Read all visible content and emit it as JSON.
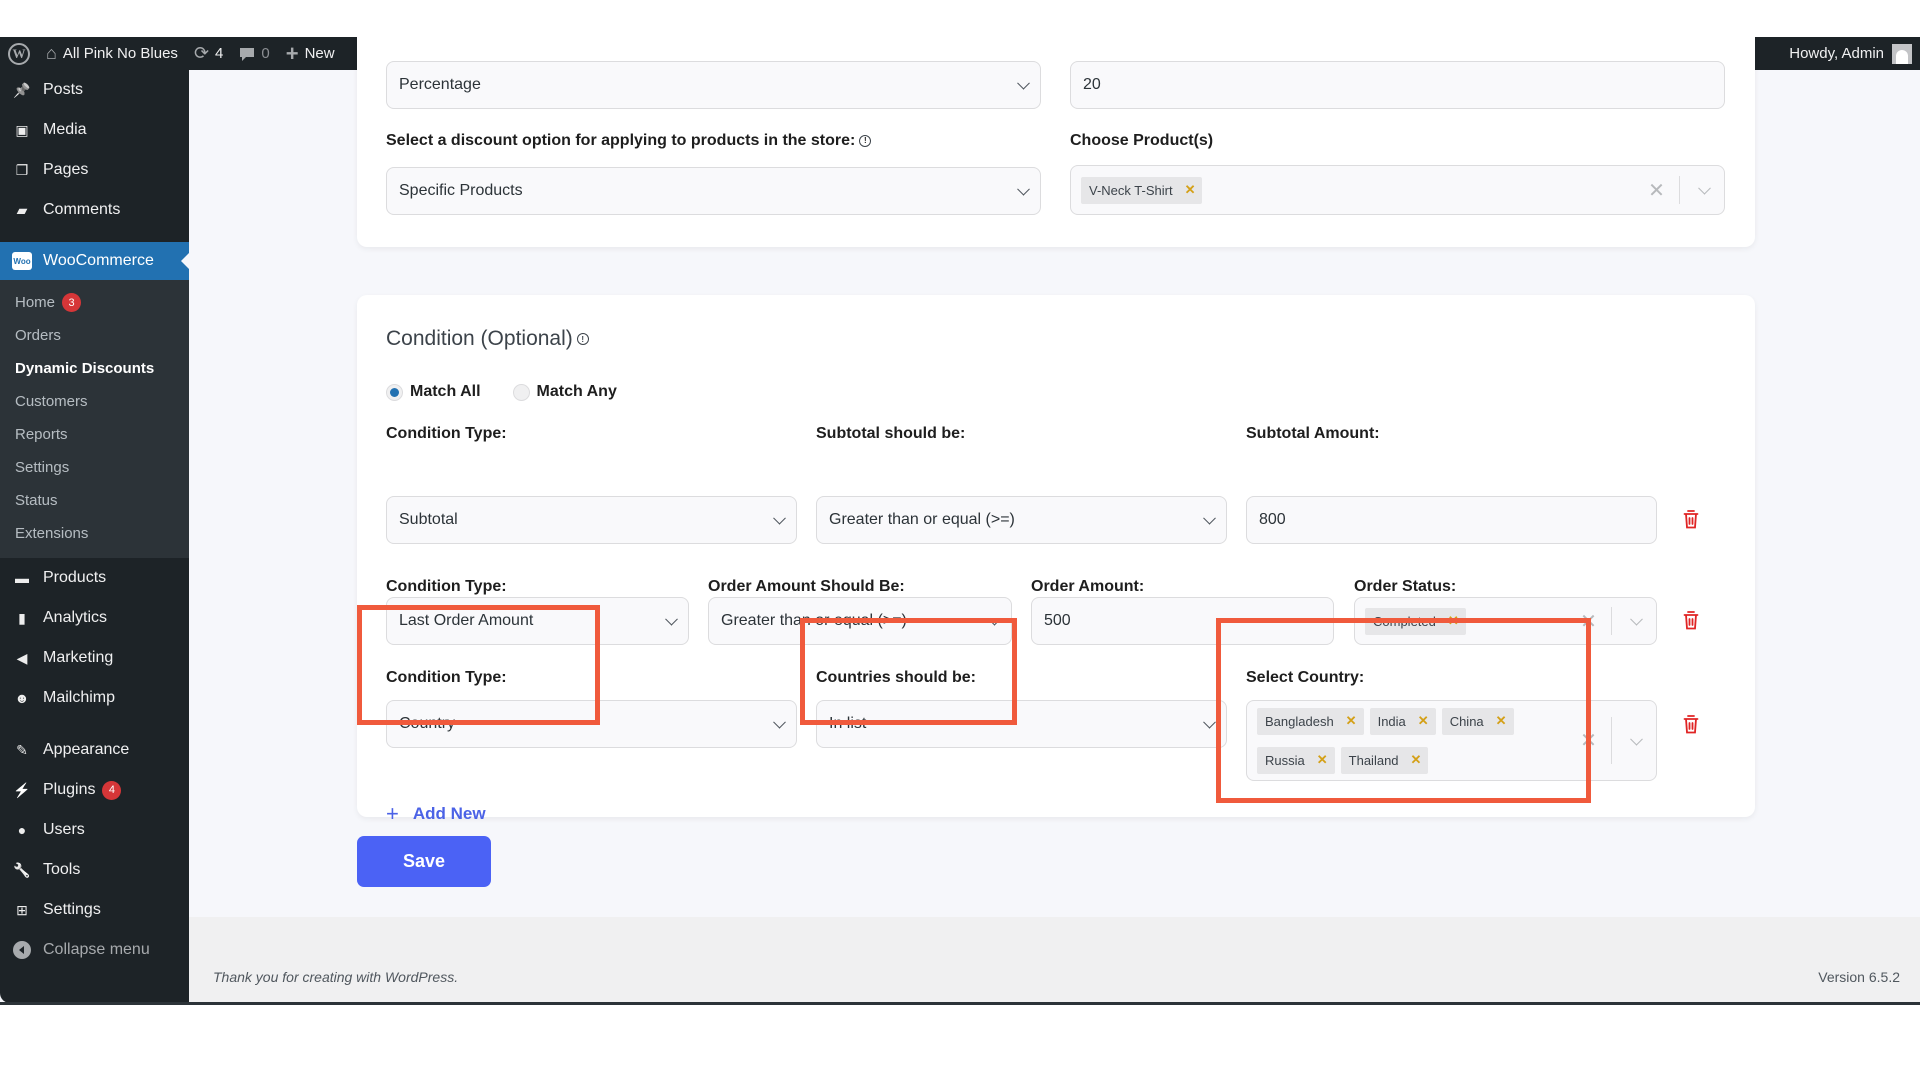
{
  "admin_bar": {
    "site_name": "All Pink No Blues",
    "updates_count": "4",
    "comments_count": "0",
    "new_label": "New",
    "greeting": "Howdy, Admin"
  },
  "sidebar": {
    "top_items": [
      {
        "label": "Posts",
        "icon": "pin-icon"
      },
      {
        "label": "Media",
        "icon": "media-icon"
      },
      {
        "label": "Pages",
        "icon": "pages-icon"
      },
      {
        "label": "Comments",
        "icon": "comment-icon"
      }
    ],
    "woocommerce": {
      "label": "WooCommerce",
      "logo_text": "Woo",
      "submenu": [
        {
          "label": "Home",
          "badge": "3"
        },
        {
          "label": "Orders"
        },
        {
          "label": "Dynamic Discounts",
          "current": true
        },
        {
          "label": "Customers"
        },
        {
          "label": "Reports"
        },
        {
          "label": "Settings"
        },
        {
          "label": "Status"
        },
        {
          "label": "Extensions"
        }
      ]
    },
    "mid_items": [
      {
        "label": "Products",
        "icon": "archive-icon"
      },
      {
        "label": "Analytics",
        "icon": "bar-chart-icon"
      },
      {
        "label": "Marketing",
        "icon": "megaphone-icon"
      },
      {
        "label": "Mailchimp",
        "icon": "mailchimp-icon"
      }
    ],
    "bottom_items": [
      {
        "label": "Appearance",
        "icon": "paintbrush-icon"
      },
      {
        "label": "Plugins",
        "icon": "plugin-icon",
        "badge": "4"
      },
      {
        "label": "Users",
        "icon": "user-icon"
      },
      {
        "label": "Tools",
        "icon": "wrench-icon"
      },
      {
        "label": "Settings",
        "icon": "settings-icon"
      }
    ],
    "collapse_label": "Collapse menu"
  },
  "discount": {
    "type_value": "Percentage",
    "amount_value": "20",
    "apply_label": "Select a discount option for applying to products in the store:",
    "apply_value": "Specific Products",
    "products_label": "Choose Product(s)",
    "products": [
      "V-Neck T-Shirt"
    ]
  },
  "conditions": {
    "heading": "Condition (Optional)",
    "match_all": "Match All",
    "match_any": "Match Any",
    "match_selected": "all",
    "rows": [
      {
        "type_label": "Condition Type:",
        "type_value": "Subtotal",
        "op_label": "Subtotal should be:",
        "op_value": "Greater than or equal (>=)",
        "amount_label": "Subtotal Amount:",
        "amount_value": "800"
      },
      {
        "type_label": "Condition Type:",
        "type_value": "Last Order Amount",
        "op_label": "Order Amount Should Be:",
        "op_value": "Greater than or equal (>=)",
        "amount_label": "Order Amount:",
        "amount_value": "500",
        "status_label": "Order Status:",
        "status_tags": [
          "Completed"
        ]
      },
      {
        "type_label": "Condition Type:",
        "type_value": "Country",
        "op_label": "Countries should be:",
        "op_value": "In list",
        "country_label": "Select Country:",
        "country_tags": [
          "Bangladesh",
          "India",
          "China",
          "Russia",
          "Thailand"
        ]
      }
    ],
    "add_new_label": "Add New"
  },
  "save_label": "Save",
  "footer": {
    "thanks": "Thank you for creating with WordPress.",
    "version": "Version 6.5.2"
  },
  "colors": {
    "accent": "#4b62f5",
    "wp_blue": "#2271b1",
    "danger": "#e02424",
    "annotation": "#f05a3c"
  }
}
